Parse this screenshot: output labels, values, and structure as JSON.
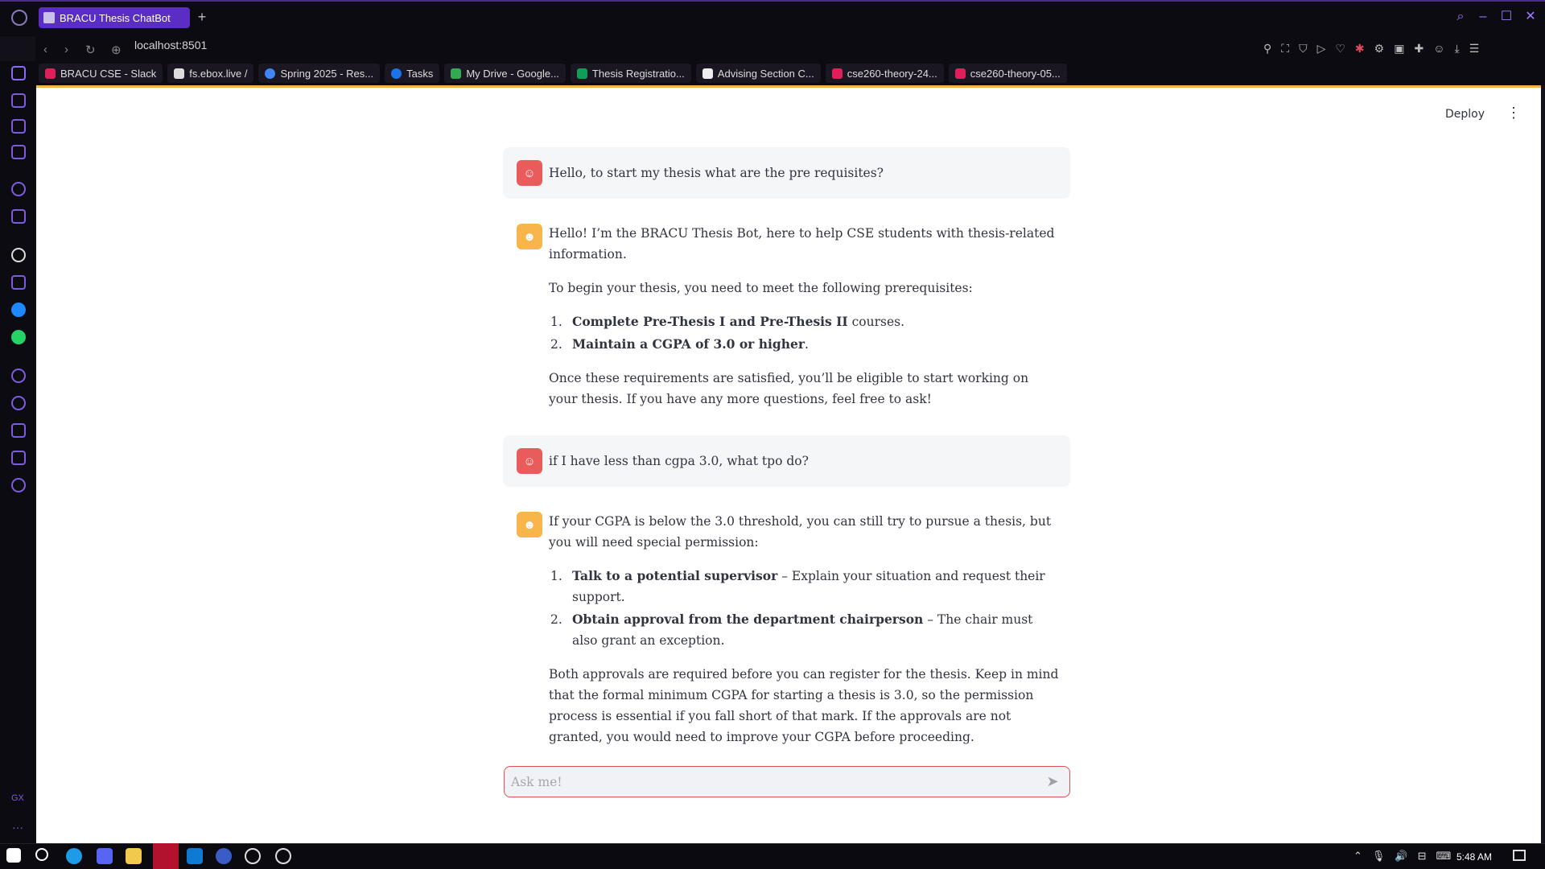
{
  "browser": {
    "tab_title": "BRACU Thesis ChatBot",
    "new_tab": "+",
    "url": "localhost:8501",
    "bookmarks": [
      "BRACU CSE - Slack",
      "fs.ebox.live /",
      "Spring 2025 - Res...",
      "Tasks",
      "My Drive - Google...",
      "Thesis Registratio...",
      "Advising Section C...",
      "cse260-theory-24...",
      "cse260-theory-05..."
    ]
  },
  "app": {
    "deploy_label": "Deploy",
    "menu_glyph": "⋮"
  },
  "chat": {
    "messages": [
      {
        "role": "user",
        "text": "Hello, to start my thesis what are the pre requisites?"
      },
      {
        "role": "assistant",
        "intro": "Hello! I’m the BRACU Thesis Bot, here to help CSE students with thesis-related information.",
        "lead": "To begin your thesis, you need to meet the following prerequisites:",
        "list": [
          {
            "num": "1.",
            "bold": "Complete Pre-Thesis I and Pre-Thesis II",
            "rest": " courses."
          },
          {
            "num": "2.",
            "bold": "Maintain a CGPA of 3.0 or higher",
            "rest": "."
          }
        ],
        "outro": "Once these requirements are satisfied, you’ll be eligible to start working on your thesis. If you have any more questions, feel free to ask!"
      },
      {
        "role": "user",
        "text": "if I have less than cgpa 3.0, what tpo do?"
      },
      {
        "role": "assistant",
        "intro": "If your CGPA is below the 3.0 threshold, you can still try to pursue a thesis, but you will need special permission:",
        "list": [
          {
            "num": "1.",
            "bold": "Talk to a potential supervisor",
            "rest": " – Explain your situation and request their support."
          },
          {
            "num": "2.",
            "bold": "Obtain approval from the department chairperson",
            "rest": " – The chair must also grant an exception."
          }
        ],
        "outro": "Both approvals are required before you can register for the thesis. Keep in mind that the formal minimum CGPA for starting a thesis is 3.0, so the permission process is essential if you fall short of that mark. If the approvals are not granted, you would need to improve your CGPA before proceeding."
      }
    ],
    "input_placeholder": "Ask me!",
    "send_glyph": "➤"
  },
  "taskbar": {
    "time": "5:48 AM"
  },
  "colors": {
    "accent": "#5a2ec4",
    "user_avatar": "#ea5b5b",
    "bot_avatar": "#f7b54b",
    "header_stripe": "#f4b24a",
    "input_border": "#e05252"
  }
}
